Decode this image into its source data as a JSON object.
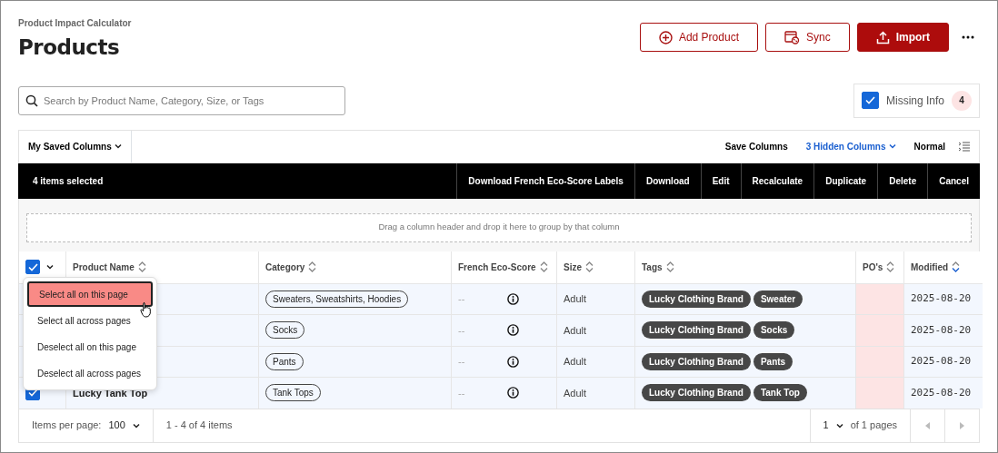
{
  "app_name": "Product Impact Calculator",
  "title": "Products",
  "actions": [
    {
      "label": "Add Product",
      "kind": "add"
    },
    {
      "label": "Sync",
      "kind": "sync"
    },
    {
      "label": "Import",
      "kind": "import"
    }
  ],
  "search": {
    "placeholder": "Search by Product Name, Category, Size, or Tags"
  },
  "missing_info": {
    "label": "Missing Info",
    "checked": true,
    "count": "4"
  },
  "toolbar": {
    "saved_columns": "My Saved Columns",
    "save_columns": "Save Columns",
    "hidden_columns": "3 Hidden Columns",
    "density": "Normal"
  },
  "selection_bar": {
    "count_text": "4 items selected",
    "actions": [
      "Download French Eco-Score Labels",
      "Download",
      "Edit",
      "Recalculate",
      "Duplicate",
      "Delete",
      "Cancel"
    ]
  },
  "group_hint": "Drag a column header and drop it here to group by that column",
  "table": {
    "select_all_checked": true,
    "columns": [
      {
        "label": "Product Name",
        "sorted": false
      },
      {
        "label": "Category",
        "sorted": false
      },
      {
        "label": "French Eco-Score",
        "sorted": false
      },
      {
        "label": "Size",
        "sorted": false
      },
      {
        "label": "Tags",
        "sorted": false
      },
      {
        "label": "PO's",
        "sorted": false
      },
      {
        "label": "Modified",
        "sorted": true
      }
    ],
    "rows": [
      {
        "category": "Sweaters, Sweatshirts, Hoodies",
        "eco_score": "--",
        "size": "Adult",
        "tags": [
          "Lucky Clothing Brand",
          "Sweater"
        ],
        "po_missing": true,
        "modified": "2025-08-20"
      },
      {
        "category": "Socks",
        "eco_score": "--",
        "size": "Adult",
        "tags": [
          "Lucky Clothing Brand",
          "Socks"
        ],
        "po_missing": true,
        "modified": "2025-08-20"
      },
      {
        "category": "Pants",
        "eco_score": "--",
        "size": "Adult",
        "tags": [
          "Lucky Clothing Brand",
          "Pants"
        ],
        "po_missing": true,
        "modified": "2025-08-20"
      },
      {
        "selected": true,
        "name": "Lucky Tank Top",
        "category": "Tank Tops",
        "eco_score": "--",
        "size": "Adult",
        "tags": [
          "Lucky Clothing Brand",
          "Tank Top"
        ],
        "po_missing": true,
        "modified": "2025-08-20"
      }
    ]
  },
  "select_menu": {
    "items": [
      {
        "label": "Select all on this page",
        "selected": true
      },
      {
        "label": "Select all across pages",
        "selected": false
      },
      {
        "label": "Deselect all on this page",
        "selected": false
      },
      {
        "label": "Deselect all across pages",
        "selected": false
      }
    ]
  },
  "pagination": {
    "items_per_page_label": "Items per page:",
    "items_per_page": "100",
    "range": "1 - 4 of 4 items",
    "page": "1",
    "page_total": "of 1 pages"
  }
}
